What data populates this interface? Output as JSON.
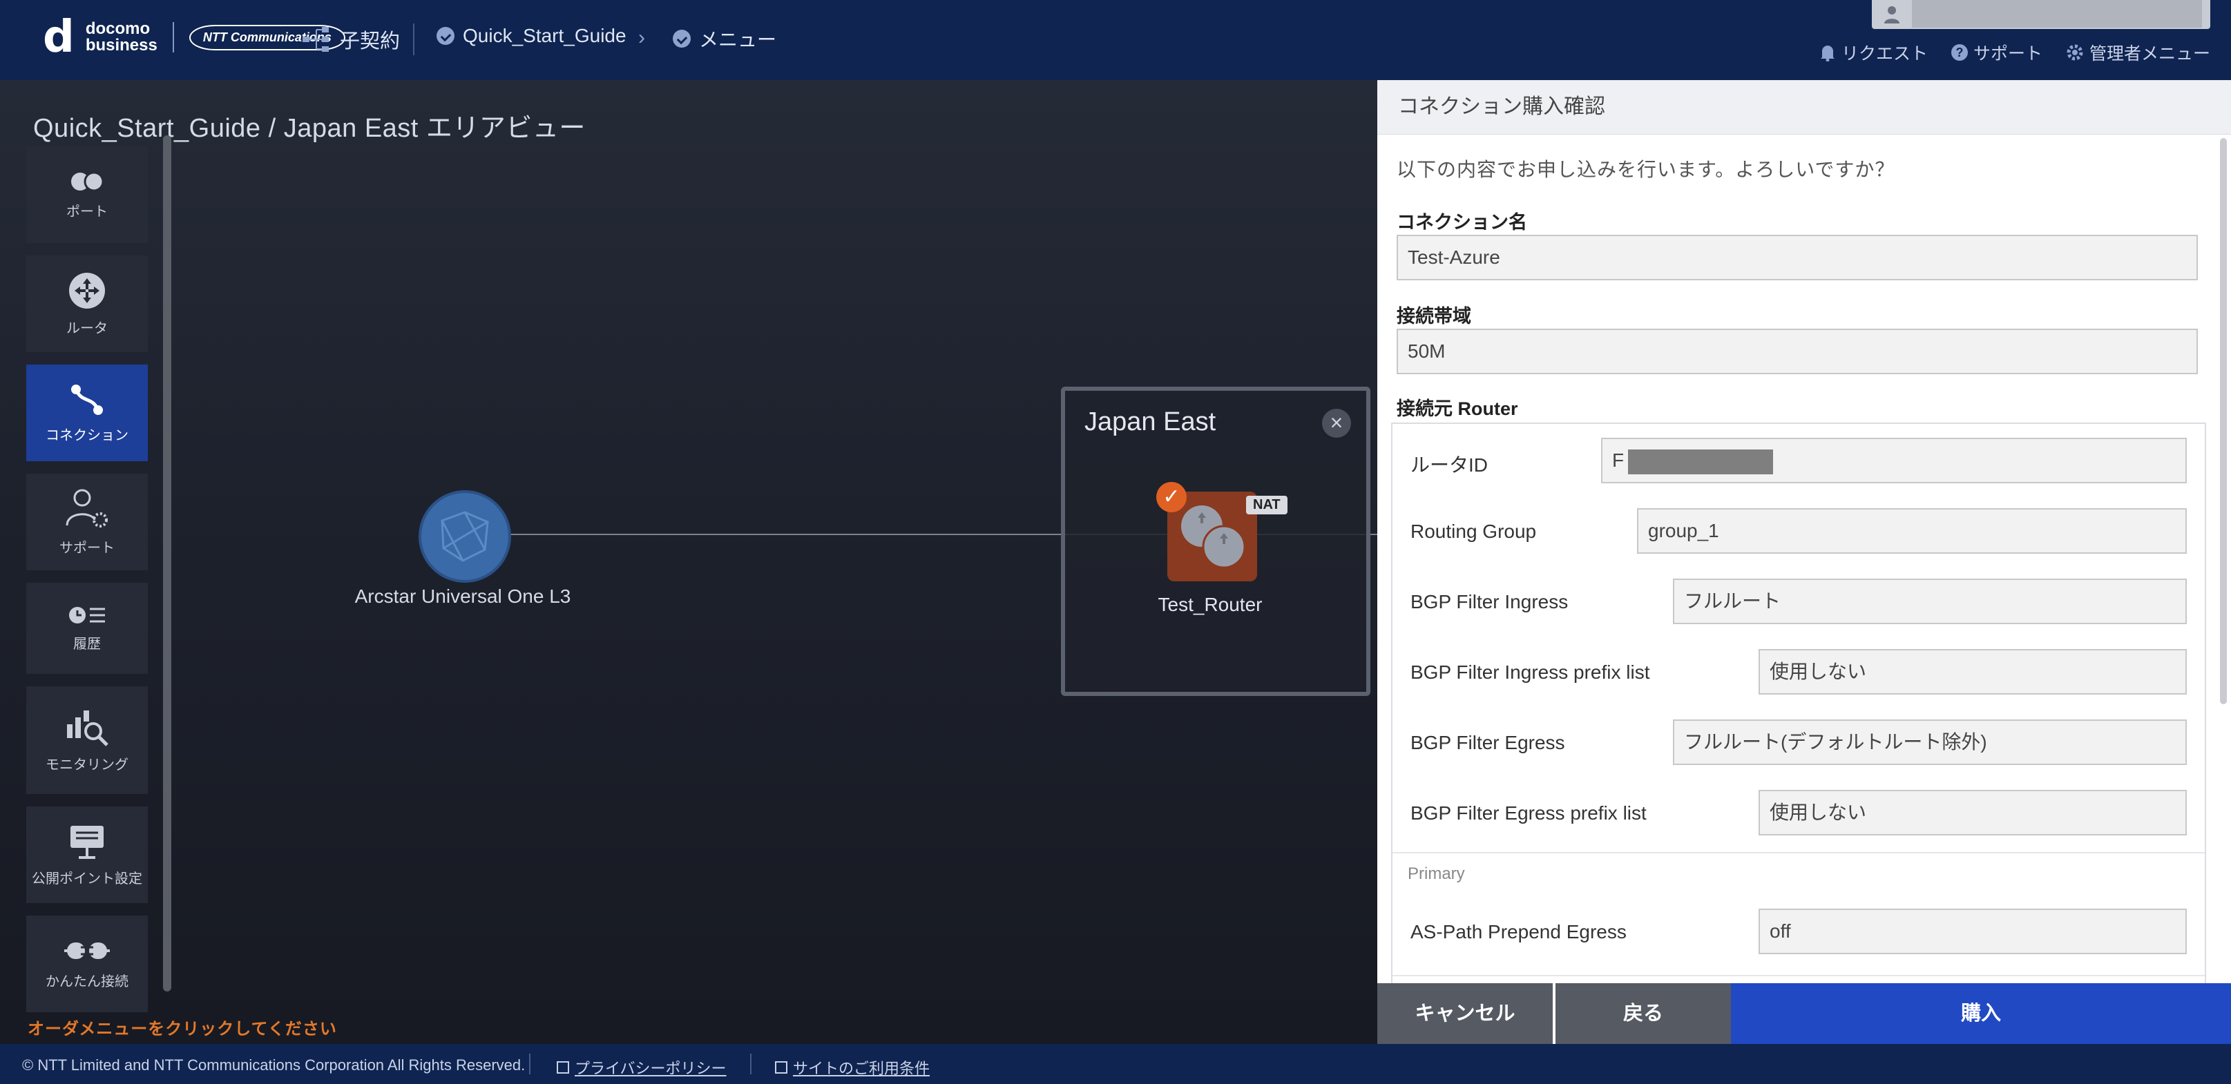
{
  "header": {
    "logo_line1": "docomo",
    "logo_line2": "business",
    "logo_ntt": "NTT Communications",
    "contract_label": "子契約",
    "breadcrumb": [
      "Quick_Start_Guide",
      "メニュー"
    ],
    "links": [
      {
        "icon": "bell-icon",
        "label": "リクエスト"
      },
      {
        "icon": "help-icon",
        "label": "サポート"
      },
      {
        "icon": "gear-icon",
        "label": "管理者メニュー"
      }
    ]
  },
  "canvas": {
    "title": "Quick_Start_Guide / Japan East エリアビュー",
    "sidebar": [
      {
        "icon": "port-icon",
        "label": "ポート"
      },
      {
        "icon": "router-icon",
        "label": "ルータ"
      },
      {
        "icon": "connection-icon",
        "label": "コネクション",
        "active": true
      },
      {
        "icon": "support-icon",
        "label": "サポート"
      },
      {
        "icon": "history-icon",
        "label": "履歴"
      },
      {
        "icon": "monitoring-icon",
        "label": "モニタリング"
      },
      {
        "icon": "public-point-icon",
        "label": "公開ポイント設定"
      },
      {
        "icon": "easy-connect-icon",
        "label": "かんたん接続"
      }
    ],
    "hint": "オーダメニューをクリックしてください",
    "cloud_label": "Arcstar Universal One L3",
    "area": {
      "title": "Japan East",
      "close": "×",
      "router_label": "Test_Router",
      "nat_badge": "NAT",
      "check": "✓"
    }
  },
  "panel": {
    "title": "コネクション購入確認",
    "intro": "以下の内容でお申し込みを行います。よろしいですか？",
    "connection_name_label": "コネクション名",
    "connection_name": "Test-Azure",
    "bandwidth_label": "接続帯域",
    "bandwidth": "50M",
    "source_router_label": "接続元 Router",
    "router_id_label": "ルータID",
    "router_id": "F",
    "routing_group_label": "Routing Group",
    "routing_group": "group_1",
    "bgp_ingress_label": "BGP Filter Ingress",
    "bgp_ingress": "フルルート",
    "bgp_ingress_prefix_label": "BGP Filter Ingress prefix list",
    "bgp_ingress_prefix": "使用しない",
    "bgp_egress_label": "BGP Filter Egress",
    "bgp_egress": "フルルート(デフォルトルート除外)",
    "bgp_egress_prefix_label": "BGP Filter Egress prefix list",
    "bgp_egress_prefix": "使用しない",
    "primary_label": "Primary",
    "as_path_label": "AS-Path Prepend Egress",
    "as_path": "off",
    "buttons": {
      "cancel": "キャンセル",
      "back": "戻る",
      "buy": "購入"
    }
  },
  "footer": {
    "copyright": "© NTT Limited and NTT Communications Corporation All Rights Reserved.",
    "privacy": "プライバシーポリシー",
    "terms": "サイトのご利用条件"
  }
}
